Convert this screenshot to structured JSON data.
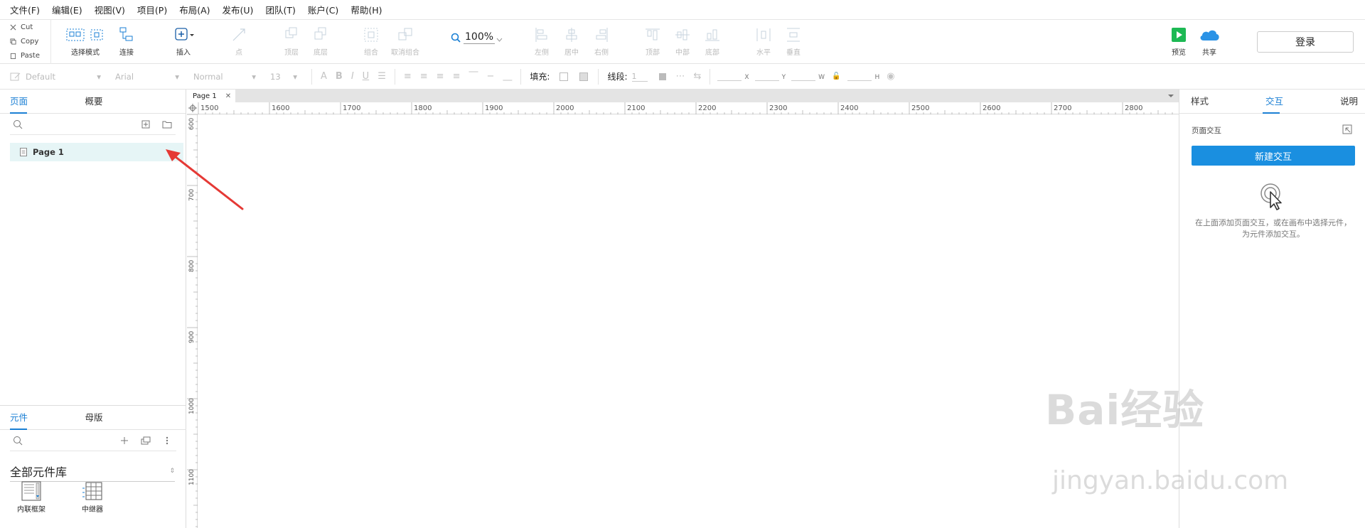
{
  "menubar": {
    "items": [
      "文件(F)",
      "编辑(E)",
      "视图(V)",
      "项目(P)",
      "布局(A)",
      "发布(U)",
      "团队(T)",
      "账户(C)",
      "帮助(H)"
    ]
  },
  "clipboard": {
    "cut": "Cut",
    "copy": "Copy",
    "paste": "Paste"
  },
  "toolbar": {
    "select_mode": "选择模式",
    "connect": "连接",
    "insert": "插入",
    "point": "点",
    "front": "顶层",
    "back": "底层",
    "group": "组合",
    "ungroup": "取消组合",
    "zoom": "100%",
    "align_left": "左侧",
    "align_center": "居中",
    "align_right": "右侧",
    "align_top": "顶部",
    "align_middle": "中部",
    "align_bottom": "底部",
    "distribute_h": "水平",
    "distribute_v": "垂直",
    "preview": "预览",
    "share": "共享",
    "login": "登录"
  },
  "formatbar": {
    "style": "Default",
    "font": "Arial",
    "weight": "Normal",
    "size": "13",
    "fill_label": "填充:",
    "line_label": "线段:",
    "line_value": "1",
    "x_label": "X",
    "y_label": "Y",
    "w_label": "W",
    "h_label": "H"
  },
  "left_panel": {
    "tabs": [
      "页面",
      "概要"
    ],
    "pages": [
      "Page 1"
    ],
    "lib_tabs": [
      "元件",
      "母版"
    ],
    "library_title": "全部元件库",
    "widgets": [
      "内联框架",
      "中继器"
    ]
  },
  "canvas": {
    "doc_tab": "Page 1",
    "ruler_h": [
      "1500",
      "1600",
      "1700",
      "1800",
      "1900",
      "2000",
      "2100",
      "2200",
      "2300",
      "2400",
      "2500",
      "2600",
      "2700",
      "2800"
    ],
    "ruler_v": [
      "600",
      "700",
      "800",
      "900",
      "1000",
      "1100"
    ]
  },
  "right_panel": {
    "tabs": [
      "样式",
      "交互",
      "说明"
    ],
    "section_label": "页面交互",
    "new_interaction": "新建交互",
    "hint": "在上面添加页面交互，或在画布中选择元件，为元件添加交互。"
  },
  "watermark": {
    "main": "Bai经验",
    "sub": "jingyan.baidu.com"
  },
  "colors": {
    "accent": "#1a7fd4",
    "button_blue": "#1a8fe0",
    "selected_row": "#e6f5f6",
    "arrow": "#e53935"
  }
}
